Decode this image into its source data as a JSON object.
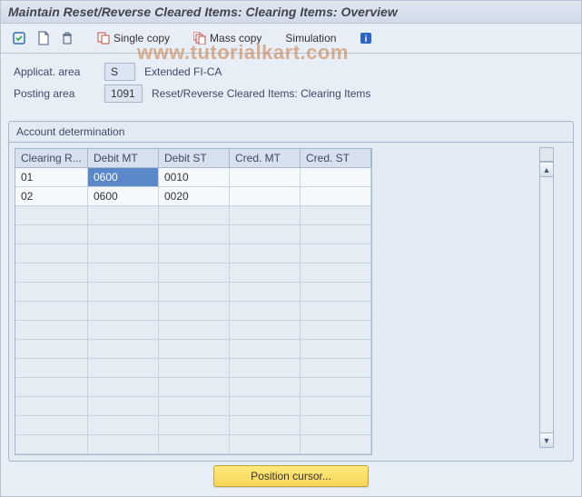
{
  "title": "Maintain Reset/Reverse Cleared Items: Clearing Items: Overview",
  "watermark": "www.tutorialkart.com",
  "toolbar": {
    "single_copy": "Single copy",
    "mass_copy": "Mass copy",
    "simulation": "Simulation"
  },
  "info": {
    "applicat_area_label": "Applicat. area",
    "applicat_area_value": "S",
    "applicat_area_desc": "Extended FI-CA",
    "posting_area_label": "Posting area",
    "posting_area_value": "1091",
    "posting_area_desc": "Reset/Reverse Cleared Items: Clearing Items"
  },
  "panel_title": "Account determination",
  "columns": {
    "c1": "Clearing R...",
    "c2": "Debit MT",
    "c3": "Debit ST",
    "c4": "Cred. MT",
    "c5": "Cred. ST"
  },
  "rows": [
    {
      "c1": "01",
      "c2": "0600",
      "c3": "0010",
      "c4": "",
      "c5": ""
    },
    {
      "c1": "02",
      "c2": "0600",
      "c3": "0020",
      "c4": "",
      "c5": ""
    }
  ],
  "empty_rows": 13,
  "footer_button": "Position cursor..."
}
